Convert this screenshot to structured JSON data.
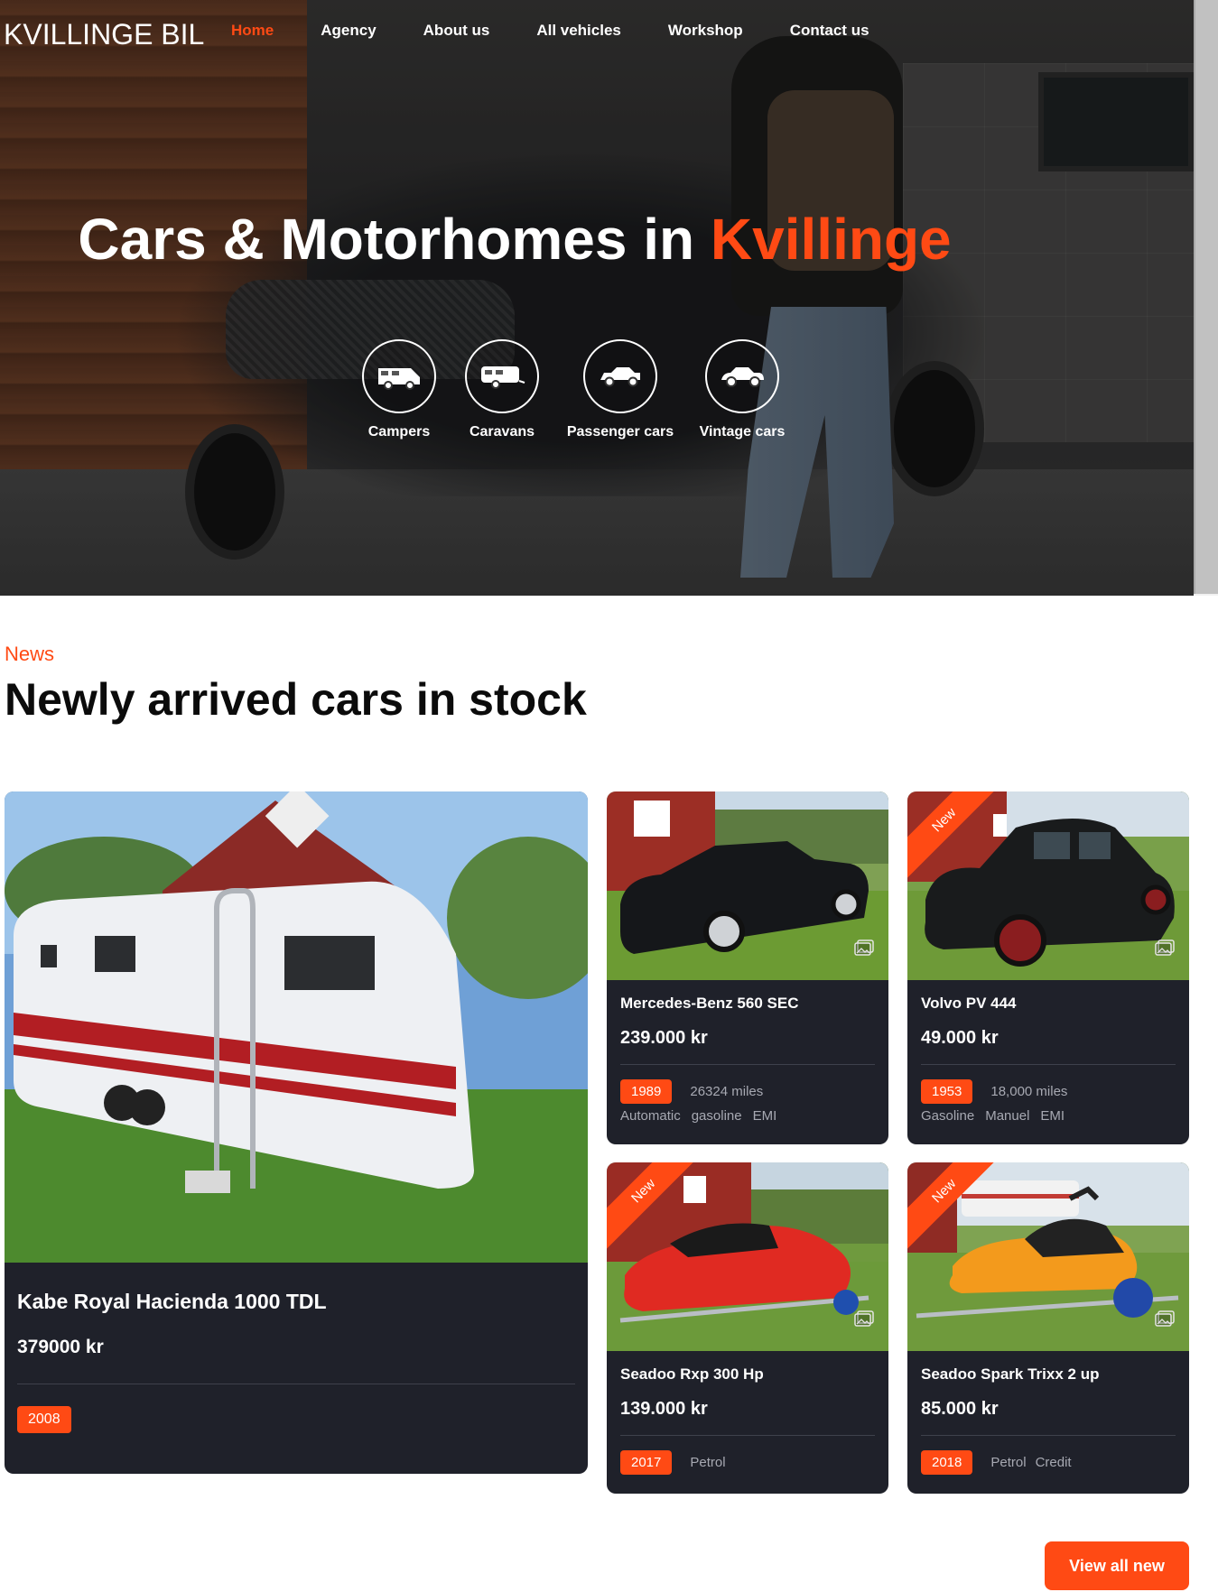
{
  "colors": {
    "accent": "#ff4a14",
    "card_bg": "#1f212a",
    "text_dark": "#0b0b0b"
  },
  "brand": {
    "logo": "KVILLINGE BIL"
  },
  "nav": {
    "items": [
      {
        "label": "Home",
        "active": true
      },
      {
        "label": "Agency"
      },
      {
        "label": "About us"
      },
      {
        "label": "All vehicles"
      },
      {
        "label": "Workshop"
      },
      {
        "label": "Contact us"
      }
    ]
  },
  "hero": {
    "title_main": "Cars & Motorhomes in ",
    "title_accent": "Kvillinge",
    "categories": [
      {
        "label": "Campers",
        "icon": "camper-icon"
      },
      {
        "label": "Caravans",
        "icon": "caravan-icon"
      },
      {
        "label": "Passenger cars",
        "icon": "passenger-car-icon"
      },
      {
        "label": "Vintage cars",
        "icon": "vintage-car-icon"
      }
    ]
  },
  "news": {
    "kicker": "News",
    "title": "Newly arrived cars in stock",
    "featured": {
      "name": "Kabe Royal Hacienda 1000 TDL",
      "price": "379000 kr",
      "year": "2008"
    },
    "cards": [
      {
        "name": "Mercedes-Benz 560 SEC",
        "price": "239.000 kr",
        "year": "1989",
        "mileage": "26324 miles",
        "specs": [
          "Automatic",
          "gasoline",
          "EMI"
        ],
        "badge": ""
      },
      {
        "name": "Volvo PV 444",
        "price": "49.000 kr",
        "year": "1953",
        "mileage": "18,000 miles",
        "specs": [
          "Gasoline",
          "Manuel",
          "EMI"
        ],
        "badge": "New"
      },
      {
        "name": "Seadoo Rxp 300 Hp",
        "price": "139.000 kr",
        "year": "2017",
        "mileage": "",
        "specs": [
          "Petrol"
        ],
        "badge": "New"
      },
      {
        "name": "Seadoo Spark Trixx 2 up",
        "price": "85.000 kr",
        "year": "2018",
        "mileage": "",
        "specs": [
          "Petrol",
          "Credit"
        ],
        "badge": "New"
      }
    ],
    "view_all": "View all new"
  }
}
